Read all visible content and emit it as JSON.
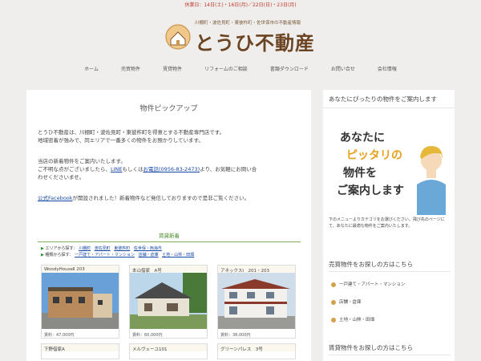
{
  "notice": "休業日：14日(土)・16日(月)／22日(日)・23日(月)",
  "header": {
    "tagline": "川棚町・波佐見町・東彼杵町・佐世保市の不動産情報",
    "brand": "とうひ不動産"
  },
  "nav": [
    "ホーム",
    "売買物件",
    "賃貸物件",
    "リフォームのご相談",
    "書類ダウンロード",
    "お問い合せ",
    "会社情報"
  ],
  "main": {
    "title": "物件ピックアップ",
    "p1a": "とうひ不動産は、川棚町・波佐見町・東彼杵町を得意とする不動産専門店です。",
    "p1b": "地域密着が強みで、同エリアで一番多くの物件をお預かりしています。",
    "p2a": "当店の新着物件をご案内いたします。",
    "p2b_pre": "ご不明な点がございましたら、",
    "line_link": "LINE",
    "p2b_mid": "もしくは",
    "tel_link": "お電話(0956-83-2473)",
    "p2b_post": "より、お気軽にお問い合",
    "p2c": "わせくださいませ。",
    "fb_link": "公式Facebook",
    "p3_post": "が開設されました！新着物件など発信しておりますので是非ご覧ください。"
  },
  "listing": {
    "title": "賃貸新着",
    "area_label": "エリアから探す：",
    "areas": [
      "川棚町",
      "波佐見町",
      "東彼杵町",
      "佐世保・西海市"
    ],
    "type_label": "種類から探す：",
    "types": [
      "一戸建て・アパート・マンション",
      "店舗・倉庫",
      "土地・山林・田畑"
    ],
    "cards": [
      {
        "name": "WoodyHouseⅡ 203",
        "rent": "賃料：47,000円"
      },
      {
        "name": "本山借家　A号",
        "rent": "賃料：60,000円"
      },
      {
        "name": "アネックスⅠ　201・203",
        "rent": "賃料：38,000円"
      }
    ],
    "cards2": [
      "下野借家A",
      "メルヴェーユ101",
      "グリーンパレス　3号"
    ]
  },
  "sidebar": {
    "heading": "あなたにぴったりの物件をご案内します",
    "banner_line1": "あなたに",
    "banner_line2": "ピッタリの",
    "banner_line3": "物件を",
    "banner_line4": "ご案内します",
    "desc": "下のメニューよりカテゴリをお選びください。飛び先のページにて、あなたに最適な物件をご案内いたします。",
    "sale_heading": "売買物件をお探しの方はこちら",
    "sale_items": [
      "一戸建て・アパート・マンション",
      "店舗・倉庫",
      "土地・山林・田畑"
    ],
    "rent_heading": "賃貸物件をお探しの方はこちら"
  }
}
